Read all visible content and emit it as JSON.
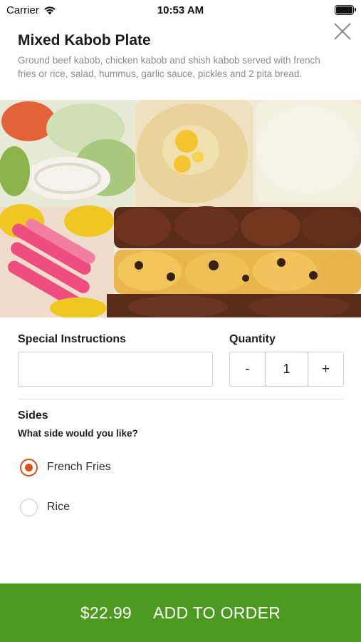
{
  "status_bar": {
    "carrier": "Carrier",
    "time": "10:53 AM",
    "wifi_icon": "wifi-icon",
    "battery_icon": "battery-icon"
  },
  "item": {
    "title": "Mixed Kabob Plate",
    "description": "Ground beef kabob, chicken kabob and shish kabob served with french fries or rice, salad, hummus, garlic sauce, pickles and 2 pita bread.",
    "image_icon": "food-photo"
  },
  "special_instructions": {
    "label": "Special Instructions",
    "value": "",
    "placeholder": ""
  },
  "quantity": {
    "label": "Quantity",
    "minus": "-",
    "value": "1",
    "plus": "+"
  },
  "sides": {
    "title": "Sides",
    "question": "What side would you like?",
    "options": [
      {
        "label": "French Fries",
        "selected": true
      },
      {
        "label": "Rice",
        "selected": false
      }
    ]
  },
  "order": {
    "price": "$22.99",
    "label": "ADD TO ORDER",
    "color": "#4c9a1f"
  },
  "colors": {
    "accent": "#d2541b",
    "order_button": "#4c9a1f",
    "description_text": "#8b8b8b"
  }
}
